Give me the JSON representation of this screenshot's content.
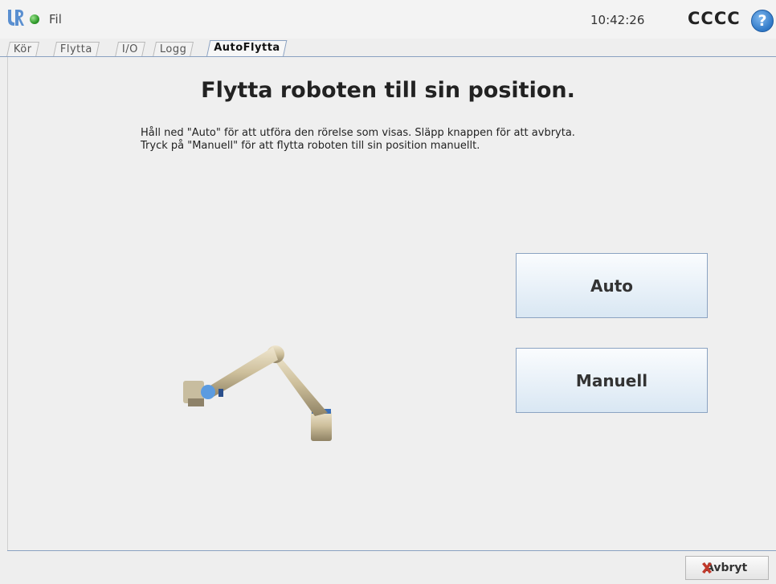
{
  "header": {
    "menu_file": "Fil",
    "clock": "10:42:26",
    "robot_name": "CCCC",
    "help_glyph": "?"
  },
  "tabs": [
    {
      "label": "Kör",
      "active": false
    },
    {
      "label": "Flytta",
      "active": false
    },
    {
      "label": "I/O",
      "active": false
    },
    {
      "label": "Logg",
      "active": false
    },
    {
      "label": "AutoFlytta",
      "active": true
    }
  ],
  "main": {
    "heading": "Flytta roboten till sin position.",
    "instruction_line1": "Håll ned \"Auto\" för att utföra den rörelse som visas. Släpp knappen för att avbryta.",
    "instruction_line2": "Tryck på \"Manuell\" för att flytta roboten till sin position manuellt.",
    "auto_label": "Auto",
    "manual_label": "Manuell"
  },
  "footer": {
    "cancel_label": "Avbryt"
  },
  "icons": {
    "logo": "ur-logo-icon",
    "status": "status-dot-icon",
    "help": "help-icon",
    "cancel": "close-x-icon"
  },
  "colors": {
    "accent_blue": "#2f78c6",
    "status_green": "#2f9a2a",
    "cancel_red": "#c0392b"
  }
}
